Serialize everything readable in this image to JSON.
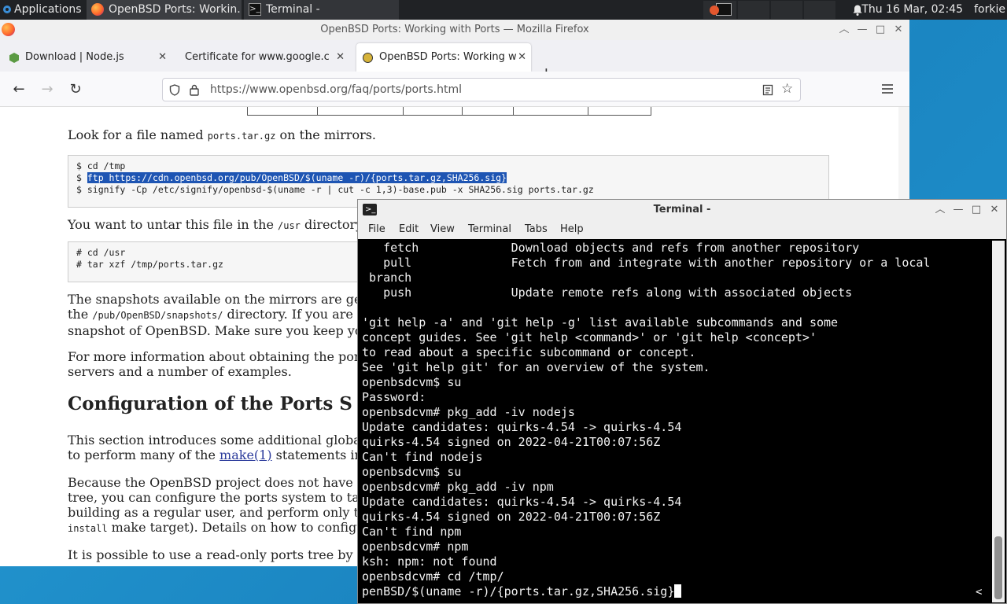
{
  "panel": {
    "applications": "Applications",
    "task_firefox": "OpenBSD Ports: Workin...",
    "task_terminal": "Terminal -",
    "clock": "Thu 16 Mar, 02:45",
    "user": "forkie"
  },
  "firefox": {
    "window_title": "OpenBSD Ports: Working with Ports — Mozilla Firefox",
    "tabs": [
      {
        "label": "Download | Node.js"
      },
      {
        "label": "Certificate for www.google.c"
      },
      {
        "label": "OpenBSD Ports: Working w"
      }
    ],
    "url": "https://www.openbsd.org/faq/ports/ports.html",
    "page": {
      "p1_a": "Look for a file named ",
      "p1_code": "ports.tar.gz",
      "p1_b": " on the mirrors.",
      "code1_l1": "$ cd /tmp",
      "code1_l2_prefix": "$ ",
      "code1_l2_hl": "ftp https://cdn.openbsd.org/pub/OpenBSD/$(uname -r)/{ports.tar.gz,SHA256.sig}",
      "code1_l3": "$ signify -Cp /etc/signify/openbsd-$(uname -r | cut -c 1,3)-base.pub -x SHA256.sig ports.tar.gz",
      "p2_a": "You want to untar this file in the ",
      "p2_code": "/usr",
      "p2_b": " directory",
      "code2_l1": "# cd /usr",
      "code2_l2": "# tar xzf /tmp/ports.tar.gz",
      "p3_l1": "The snapshots available on the mirrors are ge",
      "p3_l2_a": "the ",
      "p3_l2_code": "/pub/OpenBSD/snapshots/",
      "p3_l2_b": " directory. If you are u",
      "p3_l3": "snapshot of OpenBSD. Make sure you keep yo",
      "p4_l1": "For more information about obtaining the por",
      "p4_l2": "servers and a number of examples.",
      "h2": "Configuration of the Ports S",
      "p5_l1": "This section introduces some additional globa",
      "p5_l2_a": "to perform many of the ",
      "p5_l2_link": "make(1)",
      "p5_l2_b": " statements in",
      "p6_l1": "Because the OpenBSD project does not have t",
      "p6_l2": "tree, you can configure the ports system to tak",
      "p6_l3": "building as a regular user, and perform only t",
      "p6_l4_code": "install",
      "p6_l4_b": " make target). Details on how to configu",
      "p7_l1": "It is possible to use a read-only ports tree by s"
    }
  },
  "terminal": {
    "title": "Terminal -",
    "menu": [
      "File",
      "Edit",
      "View",
      "Terminal",
      "Tabs",
      "Help"
    ],
    "lines": [
      "   fetch             Download objects and refs from another repository",
      "   pull              Fetch from and integrate with another repository or a local",
      " branch",
      "   push              Update remote refs along with associated objects",
      "",
      "'git help -a' and 'git help -g' list available subcommands and some",
      "concept guides. See 'git help <command>' or 'git help <concept>'",
      "to read about a specific subcommand or concept.",
      "See 'git help git' for an overview of the system.",
      "openbsdcvm$ su",
      "Password:",
      "openbsdcvm# pkg_add -iv nodejs",
      "Update candidates: quirks-4.54 -> quirks-4.54",
      "quirks-4.54 signed on 2022-04-21T00:07:56Z",
      "Can't find nodejs",
      "openbsdcvm$ su",
      "openbsdcvm# pkg_add -iv npm",
      "Update candidates: quirks-4.54 -> quirks-4.54",
      "quirks-4.54 signed on 2022-04-21T00:07:56Z",
      "Can't find npm",
      "openbsdcvm# npm",
      "ksh: npm: not found",
      "openbsdcvm# cd /tmp/"
    ],
    "input_line": "penBSD/$(uname -r)/{ports.tar.gz,SHA256.sig}",
    "overflow_marker": "<"
  }
}
